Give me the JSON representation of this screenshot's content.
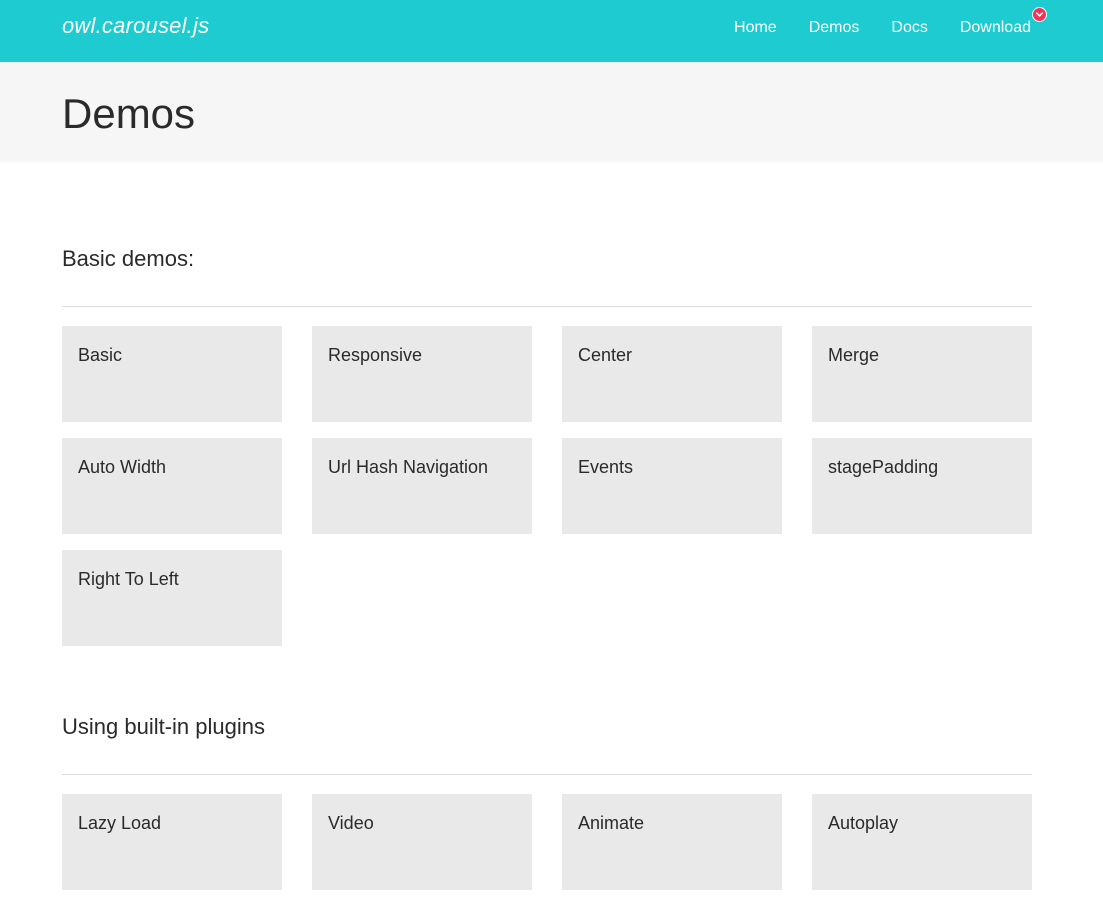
{
  "header": {
    "brand": "owl.carousel.js",
    "nav": [
      "Home",
      "Demos",
      "Docs",
      "Download"
    ],
    "badge_icon": "chevron-down-icon",
    "accent_color": "#1dcbd0",
    "badge_color": "#ee3559"
  },
  "page": {
    "title": "Demos"
  },
  "sections": [
    {
      "title": "Basic demos:",
      "items": [
        "Basic",
        "Responsive",
        "Center",
        "Merge",
        "Auto Width",
        "Url Hash Navigation",
        "Events",
        "stagePadding",
        "Right To Left"
      ]
    },
    {
      "title": "Using built-in plugins",
      "items": [
        "Lazy Load",
        "Video",
        "Animate",
        "Autoplay"
      ]
    }
  ]
}
